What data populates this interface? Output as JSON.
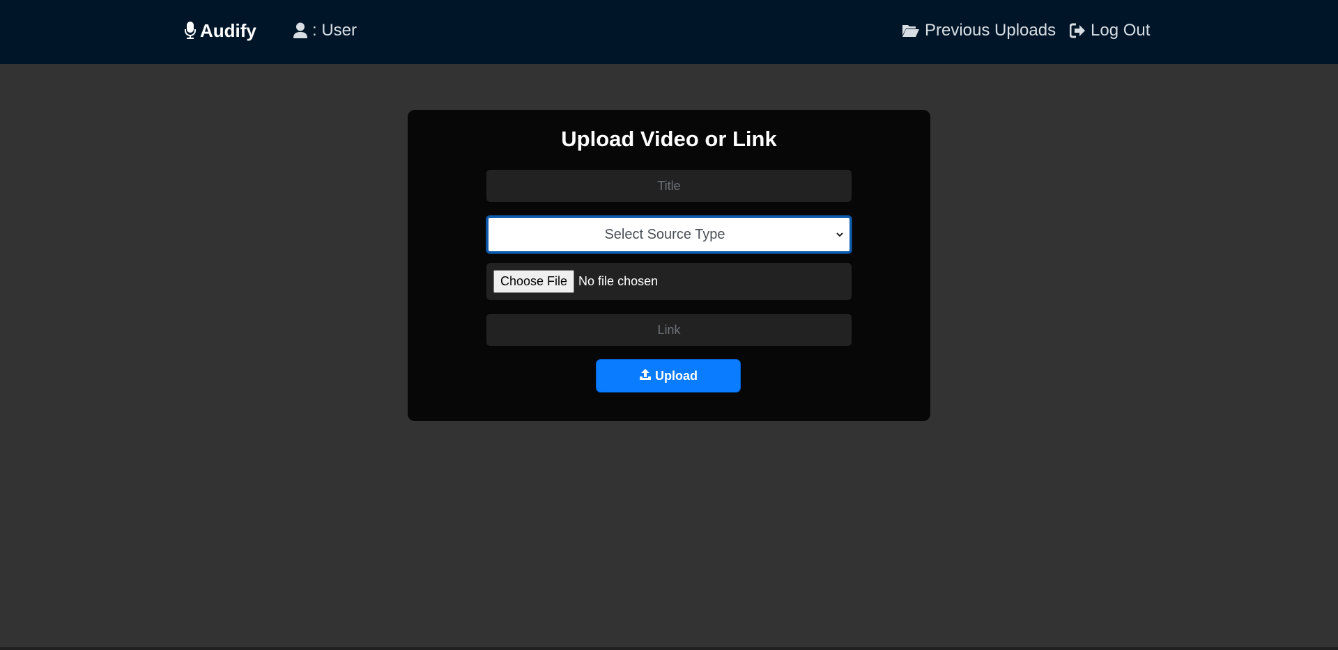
{
  "navbar": {
    "brand": {
      "label": "Audify",
      "icon": "microphone-icon"
    },
    "user": {
      "label": ": User",
      "icon": "user-icon"
    },
    "previous_uploads": {
      "label": "Previous Uploads",
      "icon": "folder-open-icon"
    },
    "logout": {
      "label": "Log Out",
      "icon": "sign-out-icon"
    }
  },
  "form": {
    "heading": "Upload Video or Link",
    "title_placeholder": "Title",
    "source_select": {
      "selected": "Select Source Type"
    },
    "file_input": {
      "button_label": "Choose File",
      "status": "No file chosen"
    },
    "link_placeholder": "Link",
    "upload_button": {
      "label": "Upload",
      "icon": "upload-icon"
    }
  },
  "colors": {
    "navbar_bg": "#001628",
    "page_bg": "#333333",
    "card_bg": "#070707",
    "accent": "#0a7cff"
  }
}
